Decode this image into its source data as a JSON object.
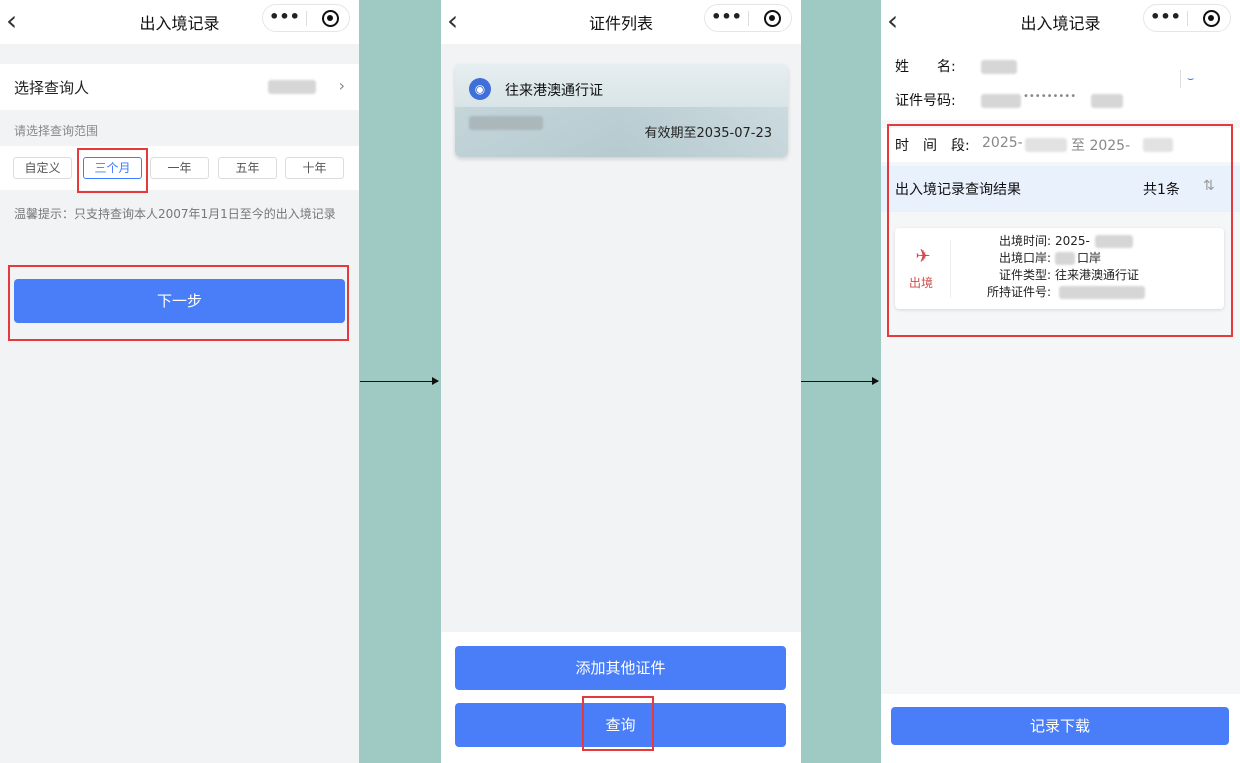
{
  "screen1": {
    "title": "出入境记录",
    "back_icon": "chevron-left-icon",
    "select_label": "选择查询人",
    "range_label": "请选择查询范围",
    "ranges": [
      "自定义",
      "三个月",
      "一年",
      "五年",
      "十年"
    ],
    "selected_range": "三个月",
    "tip": "温馨提示：只支持查询本人2007年1月1日至今的出入境记录",
    "next_button": "下一步"
  },
  "screen2": {
    "title": "证件列表",
    "card": {
      "name": "往来港澳通行证",
      "expiry": "有效期至2035-07-23"
    },
    "add_button": "添加其他证件",
    "query_button": "查询"
  },
  "screen3": {
    "title": "出入境记录",
    "name_label": "姓　　名:",
    "id_label": "证件号码:",
    "id_masked": "•••••••••",
    "time_label": "时　间　段:",
    "time_from": "2025-",
    "time_to_sep": "至 2025-",
    "result_title": "出入境记录查询结果",
    "result_count": "共1条",
    "record": {
      "tag": "出境",
      "exit_time_label": "出境时间:",
      "exit_time_value": "2025-",
      "port_label": "出境口岸:",
      "port_value": "口岸",
      "doc_type_label": "证件类型:",
      "doc_type_value": "往来港澳通行证",
      "doc_no_label": "所持证件号:"
    },
    "download_button": "记录下载"
  },
  "capsule": {
    "more": "•••"
  },
  "colors": {
    "primary": "#4a7ef8",
    "highlight": "#e6393b",
    "background": "#9fc9c3"
  }
}
